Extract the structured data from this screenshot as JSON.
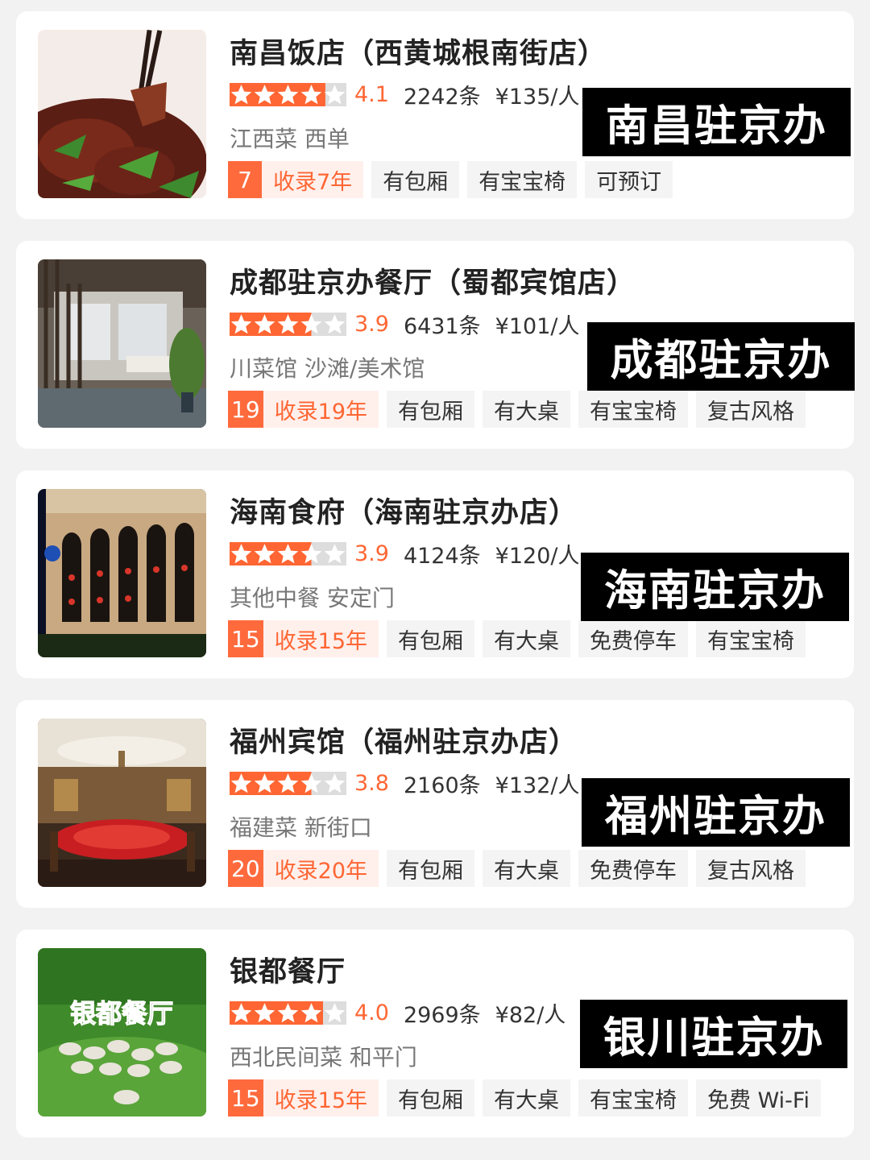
{
  "colors": {
    "accent": "#ff6633",
    "star_filled": "#ff6633",
    "star_empty": "#dddddd",
    "badge_bg": "#ff6a3d",
    "badge_light_bg": "#fff0ec",
    "tag_bg": "#f4f4f4",
    "overlay_bg": "#000000"
  },
  "restaurants": [
    {
      "name": "南昌饭店（西黄城根南街店）",
      "rating": 4.1,
      "score_label": "4.1",
      "reviews": "2242条",
      "price": "¥135/人",
      "category": "江西菜 西单",
      "badge_num": "7",
      "badge_text": "收录7年",
      "tags": [
        "有包厢",
        "有宝宝椅",
        "可预订"
      ],
      "overlay": "南昌驻京办",
      "image_icon": "food-photo"
    },
    {
      "name": "成都驻京办餐厅（蜀都宾馆店）",
      "rating": 3.5,
      "score_label": "3.9",
      "reviews": "6431条",
      "price": "¥101/人",
      "category": "川菜馆 沙滩/美术馆",
      "badge_num": "19",
      "badge_text": "收录19年",
      "tags": [
        "有包厢",
        "有大桌",
        "有宝宝椅",
        "复古风格"
      ],
      "overlay": "成都驻京办",
      "image_icon": "interior-photo"
    },
    {
      "name": "海南食府（海南驻京办店）",
      "rating": 3.5,
      "score_label": "3.9",
      "reviews": "4124条",
      "price": "¥120/人",
      "category": "其他中餐 安定门",
      "badge_num": "15",
      "badge_text": "收录15年",
      "tags": [
        "有包厢",
        "有大桌",
        "免费停车",
        "有宝宝椅"
      ],
      "overlay": "海南驻京办",
      "image_icon": "building-photo"
    },
    {
      "name": "福州宾馆（福州驻京办店）",
      "rating": 3.5,
      "score_label": "3.8",
      "reviews": "2160条",
      "price": "¥132/人",
      "category": "福建菜 新街口",
      "badge_num": "20",
      "badge_text": "收录20年",
      "tags": [
        "有包厢",
        "有大桌",
        "免费停车",
        "复古风格"
      ],
      "overlay": "福州驻京办",
      "image_icon": "banquet-hall-photo"
    },
    {
      "name": "银都餐厅",
      "rating": 4,
      "score_label": "4.0",
      "reviews": "2969条",
      "price": "¥82/人",
      "category": "西北民间菜 和平门",
      "badge_num": "15",
      "badge_text": "收录15年",
      "tags": [
        "有包厢",
        "有大桌",
        "有宝宝椅",
        "免费 Wi-Fi"
      ],
      "overlay": "银川驻京办",
      "image_icon": "grassland-sheep-photo",
      "image_text": "银都餐厅"
    }
  ]
}
